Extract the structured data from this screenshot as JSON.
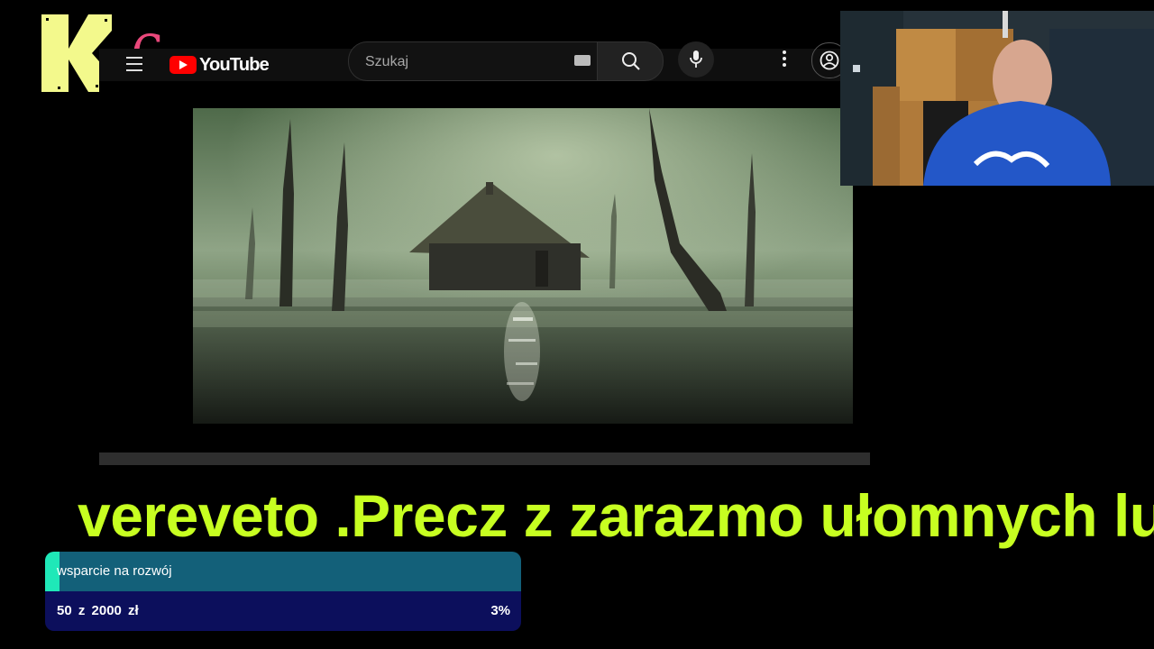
{
  "overlay": {
    "logo_letter": "K",
    "logo_number": "6"
  },
  "youtube": {
    "brand": "YouTube",
    "search_placeholder": "Szukaj"
  },
  "video": {
    "progress_fraction": 0
  },
  "ticker": {
    "text": "vereveto .Precz z zarazmo ułomnych ludzi"
  },
  "donation_goal": {
    "label": "wsparcie na rozwój",
    "amount_text": "50 z 2000 zł",
    "raised": 50,
    "target": 2000,
    "currency": "zł",
    "percent_text": "3%"
  },
  "colors": {
    "logo_yellow": "#f3f98c",
    "six_pink": "#e9487b",
    "ticker_green": "#c7ff21",
    "goal_teal": "#136079",
    "goal_fill": "#1fe8b8",
    "goal_navy": "#0c0f5c"
  }
}
